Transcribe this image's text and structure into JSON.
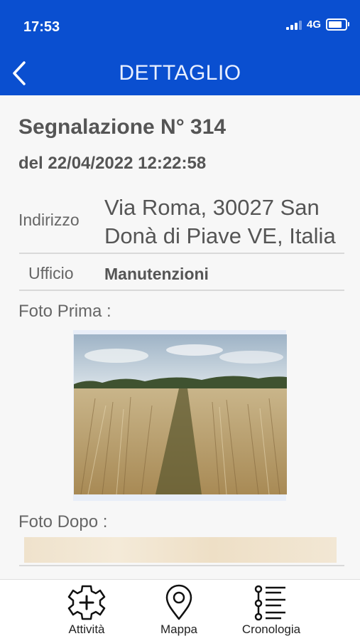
{
  "status_bar": {
    "time": "17:53",
    "network": "4G"
  },
  "header": {
    "title": "DETTAGLIO"
  },
  "report": {
    "title": "Segnalazione N° 314",
    "date": "del 22/04/2022 12:22:58",
    "address_label": "Indirizzo",
    "address_line1": "Via Roma, 30027 San",
    "address_line2": "Donà di Piave VE, Italia",
    "office_label": "Ufficio",
    "office_value": "Manutenzioni",
    "photo_before_label": "Foto Prima :",
    "photo_after_label": "Foto Dopo :"
  },
  "tabbar": {
    "items": [
      {
        "label": "Attività",
        "icon": "gear-plus-icon"
      },
      {
        "label": "Mappa",
        "icon": "map-pin-icon"
      },
      {
        "label": "Cronologia",
        "icon": "timeline-list-icon"
      }
    ]
  },
  "colors": {
    "header_bg": "#0a4fd0",
    "text": "#555555",
    "background": "#f7f7f7"
  }
}
